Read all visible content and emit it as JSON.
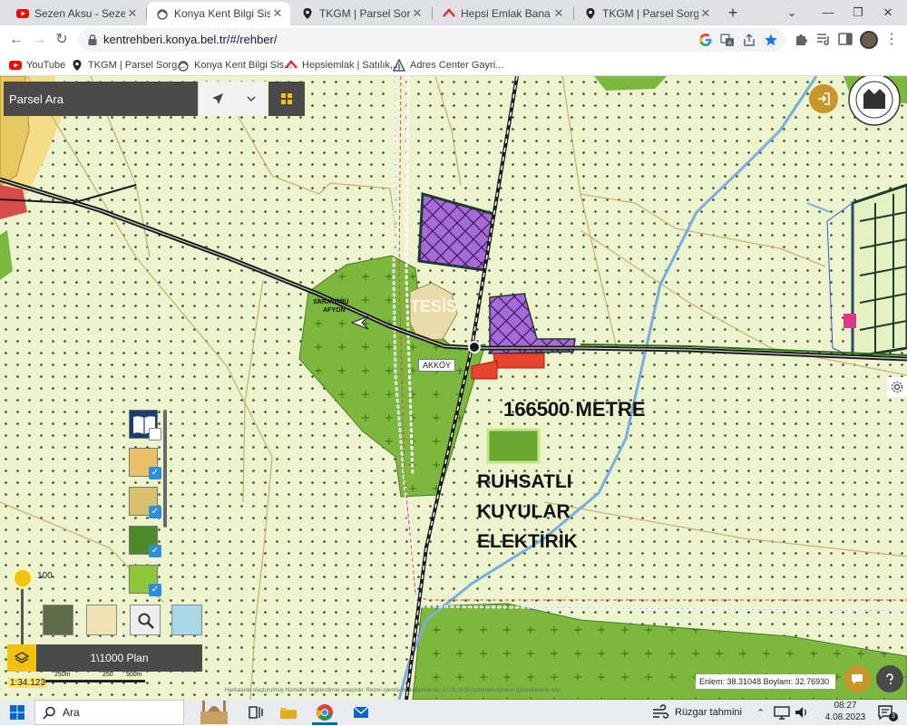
{
  "browser": {
    "tabs": [
      {
        "title": "Sezen Aksu - Sezen A",
        "icon": "youtube-icon",
        "active": false
      },
      {
        "title": "Konya Kent Bilgi Sistemi",
        "icon": "konya-logo-icon",
        "active": true
      },
      {
        "title": "TKGM | Parsel Sorgu Uyg",
        "icon": "map-pin-icon",
        "active": false
      },
      {
        "title": "Hepsi Emlak Bana Özel",
        "icon": "hepsiemlak-icon",
        "active": false
      },
      {
        "title": "TKGM | Parsel Sorgu Uyg",
        "icon": "map-pin-icon",
        "active": false
      }
    ],
    "url": "kentrehberi.konya.bel.tr/#/rehber/",
    "bookmarks": [
      {
        "label": "YouTube",
        "icon": "youtube-icon"
      },
      {
        "label": "TKGM | Parsel Sorg...",
        "icon": "map-pin-icon"
      },
      {
        "label": "Konya Kent Bilgi Sis...",
        "icon": "konya-logo-icon"
      },
      {
        "label": "Hepsiemlak | Satılık,...",
        "icon": "hepsiemlak-icon"
      },
      {
        "label": "Adres Center Gayri...",
        "icon": "adres-center-icon"
      }
    ]
  },
  "map": {
    "search_placeholder": "Parsel Ara",
    "labels": {
      "area": "166500 METRE",
      "annotation_line1": "RUHSATLI",
      "annotation_line2": "KUYULAR",
      "annotation_line3": "ELEKTİRİK",
      "village": "AKKÖY",
      "road_line1": "SARAYÖNÜ",
      "road_line2": "AFYON",
      "zone": "TESİS"
    },
    "opacity_value": "100",
    "basemap_name": "1\\1000 Plan",
    "scale": "1:34.123",
    "scale_marks": [
      "250m",
      "250",
      "500m"
    ],
    "coords": {
      "lat_label": "Enlem:",
      "lat": "38.31048",
      "lon_label": "Boylam:",
      "lon": "32.76930"
    },
    "disclaimer": "Haritalarda oluşturulmuş hizmetler bilgilendirme amaçlıdır. Resmi işlemlerde kullanılamaz. 17.05.2018 tarihinden itibaren görüntülenme sayı"
  },
  "taskbar": {
    "search_placeholder": "Ara",
    "weather": "Rüzgar tahmini",
    "time": "08:27",
    "date": "4.08.2023"
  },
  "colors": {
    "agri_bg": "#ecf4cd",
    "green_zone": "#7cb83e",
    "purple_zone": "#a86ad8",
    "accent_yellow": "#f3c20f",
    "dark_panel": "#4a4a4a"
  }
}
